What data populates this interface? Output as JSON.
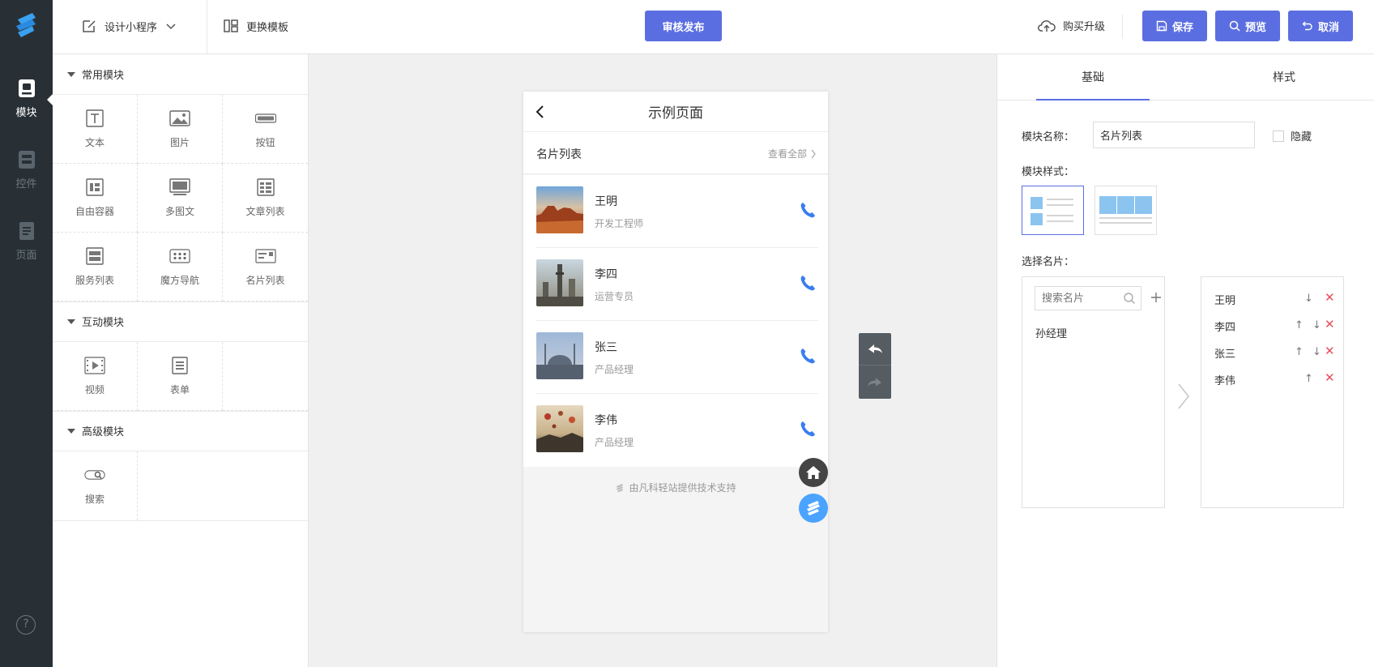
{
  "rail": {
    "items": [
      {
        "label": "模块",
        "icon": "module-icon",
        "active": true
      },
      {
        "label": "控件",
        "icon": "widget-icon",
        "active": false
      },
      {
        "label": "页面",
        "icon": "page-icon",
        "active": false
      }
    ],
    "help_icon": "help-icon"
  },
  "topbar": {
    "app_name": "设计小程序",
    "template_label": "更换模板",
    "publish_label": "审核发布",
    "upgrade_label": "购买升级",
    "save_label": "保存",
    "preview_label": "预览",
    "cancel_label": "取消"
  },
  "modules": {
    "common": {
      "title": "常用模块",
      "items": [
        {
          "label": "文本",
          "icon": "text-icon"
        },
        {
          "label": "图片",
          "icon": "image-icon"
        },
        {
          "label": "按钮",
          "icon": "button-icon"
        },
        {
          "label": "自由容器",
          "icon": "container-icon"
        },
        {
          "label": "多图文",
          "icon": "multi-image-text-icon"
        },
        {
          "label": "文章列表",
          "icon": "article-list-icon"
        },
        {
          "label": "服务列表",
          "icon": "service-list-icon"
        },
        {
          "label": "魔方导航",
          "icon": "cube-nav-icon"
        },
        {
          "label": "名片列表",
          "icon": "card-list-icon"
        }
      ]
    },
    "interactive": {
      "title": "互动模块",
      "items": [
        {
          "label": "视频",
          "icon": "video-icon"
        },
        {
          "label": "表单",
          "icon": "form-icon"
        }
      ]
    },
    "advanced": {
      "title": "高级模块",
      "items": [
        {
          "label": "搜索",
          "icon": "search-module-icon"
        }
      ]
    }
  },
  "phone": {
    "page_title": "示例页面",
    "list_title": "名片列表",
    "view_all": "查看全部",
    "cards": [
      {
        "name": "王明",
        "title": "开发工程师",
        "photo": "desert-rock-photo"
      },
      {
        "name": "李四",
        "title": "运营专员",
        "photo": "city-tower-photo"
      },
      {
        "name": "张三",
        "title": "产品经理",
        "photo": "mosque-photo"
      },
      {
        "name": "李伟",
        "title": "产品经理",
        "photo": "balloons-photo"
      }
    ],
    "footer": "由凡科轻站提供技术支持"
  },
  "settings": {
    "tabs": [
      "基础",
      "样式"
    ],
    "active_tab": "基础",
    "module_name_label": "模块名称：",
    "module_name_value": "名片列表",
    "hide_label": "隐藏",
    "hide_checked": false,
    "style_label": "模块样式：",
    "select_label": "选择名片：",
    "search_placeholder": "搜索名片",
    "available": [
      "孙经理"
    ],
    "selected": [
      "王明",
      "李四",
      "张三",
      "李伟"
    ]
  },
  "colors": {
    "accent": "#5b6ee1",
    "rail": "#283036",
    "phone_icon": "#3a7df0",
    "delete": "#e64d5c"
  }
}
